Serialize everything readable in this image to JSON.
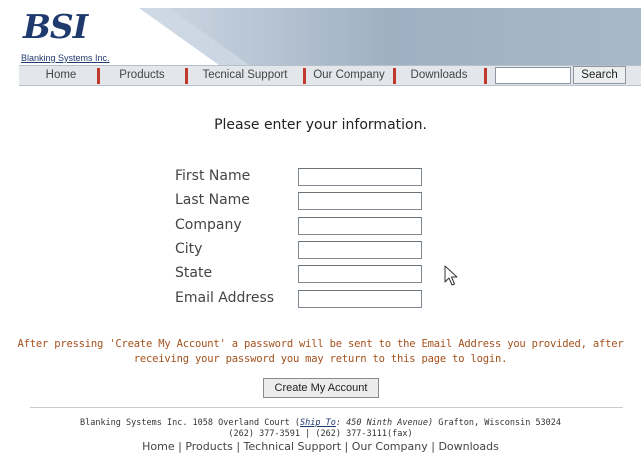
{
  "logo": {
    "text": "BSI",
    "subtitle": "Blanking Systems Inc."
  },
  "nav": {
    "items": [
      {
        "label": "Home"
      },
      {
        "label": "Products"
      },
      {
        "label": "Tecnical Support"
      },
      {
        "label": "Our Company"
      },
      {
        "label": "Downloads"
      }
    ],
    "search_value": "",
    "search_button": "Search",
    "separator_color": "#c0392b"
  },
  "form": {
    "heading": "Please enter your information.",
    "fields": [
      {
        "label": "First Name",
        "value": ""
      },
      {
        "label": "Last Name",
        "value": ""
      },
      {
        "label": "Company",
        "value": ""
      },
      {
        "label": "City",
        "value": ""
      },
      {
        "label": "State",
        "value": ""
      },
      {
        "label": "Email Address",
        "value": ""
      }
    ],
    "notice_line1": "After pressing 'Create My Account' a password will be sent to the Email Address you provided, after",
    "notice_line2": "receiving your password you may return to this page to login.",
    "submit_label": "Create My Account"
  },
  "footer": {
    "address_prefix": "Blanking Systems Inc. 1058 Overland Court (",
    "ship_to_label": "Ship To",
    "ship_to_address": ": 450 Ninth Avenue)",
    "address_suffix": " Grafton, Wisconsin 53024",
    "phone": "(262) 377-3591 | (262) 377-3111(fax)",
    "links": [
      {
        "label": "Home"
      },
      {
        "label": "Products"
      },
      {
        "label": "Technical Support"
      },
      {
        "label": "Our Company"
      },
      {
        "label": "Downloads"
      }
    ],
    "link_separator": "|"
  },
  "colors": {
    "brand": "#1f3a6e",
    "notice": "#a4511d"
  },
  "cursor": "mouse-pointer-icon"
}
